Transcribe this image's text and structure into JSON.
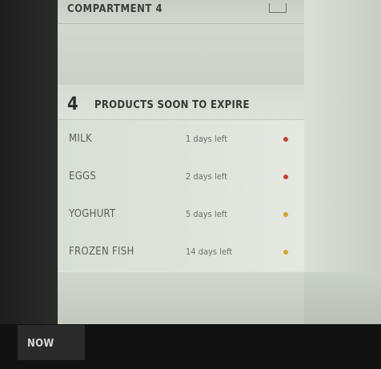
{
  "compartment": {
    "label": "COMPARTMENT 4",
    "icon": "image-icon"
  },
  "expire_panel": {
    "count": "4",
    "title": "PRODUCTS SOON TO EXPIRE",
    "items": [
      {
        "name": "MILK",
        "days": "1 days left",
        "status_color": "#c8402e"
      },
      {
        "name": "EGGS",
        "days": "2 days left",
        "status_color": "#c8402e"
      },
      {
        "name": "YOGHURT",
        "days": "5 days left",
        "status_color": "#d9a227"
      },
      {
        "name": "FROZEN FISH",
        "days": "14 days left",
        "status_color": "#d9a227"
      }
    ]
  },
  "footer": {
    "now_label": "NOW"
  }
}
